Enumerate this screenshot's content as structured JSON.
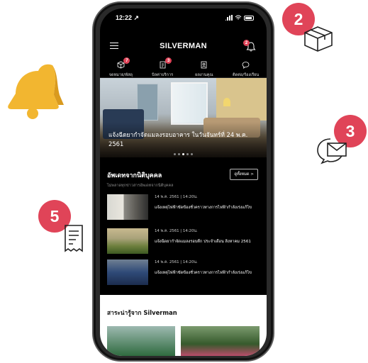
{
  "decorations": {
    "badge_box": "2",
    "badge_mail": "3",
    "badge_receipt": "5",
    "badge_color": "#e04458",
    "icons": [
      "bell-icon",
      "box-icon",
      "mail-chat-icon",
      "receipt-icon"
    ]
  },
  "status_bar": {
    "time": "12:22 ↗"
  },
  "app_bar": {
    "logo": "SILVERMAN",
    "notification_count": "2"
  },
  "nav": [
    {
      "label": "จดหมาย/พัสดุ",
      "icon": "box-icon",
      "badge": "7"
    },
    {
      "label": "บิลค่าบริการ",
      "icon": "bill-icon",
      "badge": "3"
    },
    {
      "label": "ผลงานคุณ",
      "icon": "person-card-icon",
      "badge": ""
    },
    {
      "label": "ติดต่อ/ร้องเรียน",
      "icon": "chat-icon",
      "badge": ""
    }
  ],
  "hero": {
    "title": "แจ้งฉีดยากำจัดแมลงรอบอาคาร ในวันจันทร์ที่ 24 พ.ค. 2561",
    "slide_count": 5,
    "active_slide": 3
  },
  "updates": {
    "title": "อัพเดทจากนิติบุคคล",
    "subtitle": "ไม่พลาดทุกข่าวสารอัพเดทจากนิติบุคคล",
    "see_all": "ดูทั้งหมด  >",
    "items": [
      {
        "date": "14 พ.ค. 2561 | 14:20น.",
        "text": "แจ้งเหตุไฟฟ้าขัดข้องชั่วคราวทางการไฟฟ้ากำลังเร่งแก้ไข"
      },
      {
        "date": "14 พ.ค. 2561 | 14:20น.",
        "text": "แจ้งฉีดยากำจัดแมลงรอบตึก ประจำเดือน สิงหาคม 2561"
      },
      {
        "date": "14 พ.ค. 2561 | 14:20น.",
        "text": "แจ้งเหตุไฟฟ้าขัดข้องชั่วคราวทางการไฟฟ้ากำลังเร่งแก้ไข"
      }
    ]
  },
  "knowledge": {
    "title": "สาระน่ารู้จาก Silverman"
  }
}
